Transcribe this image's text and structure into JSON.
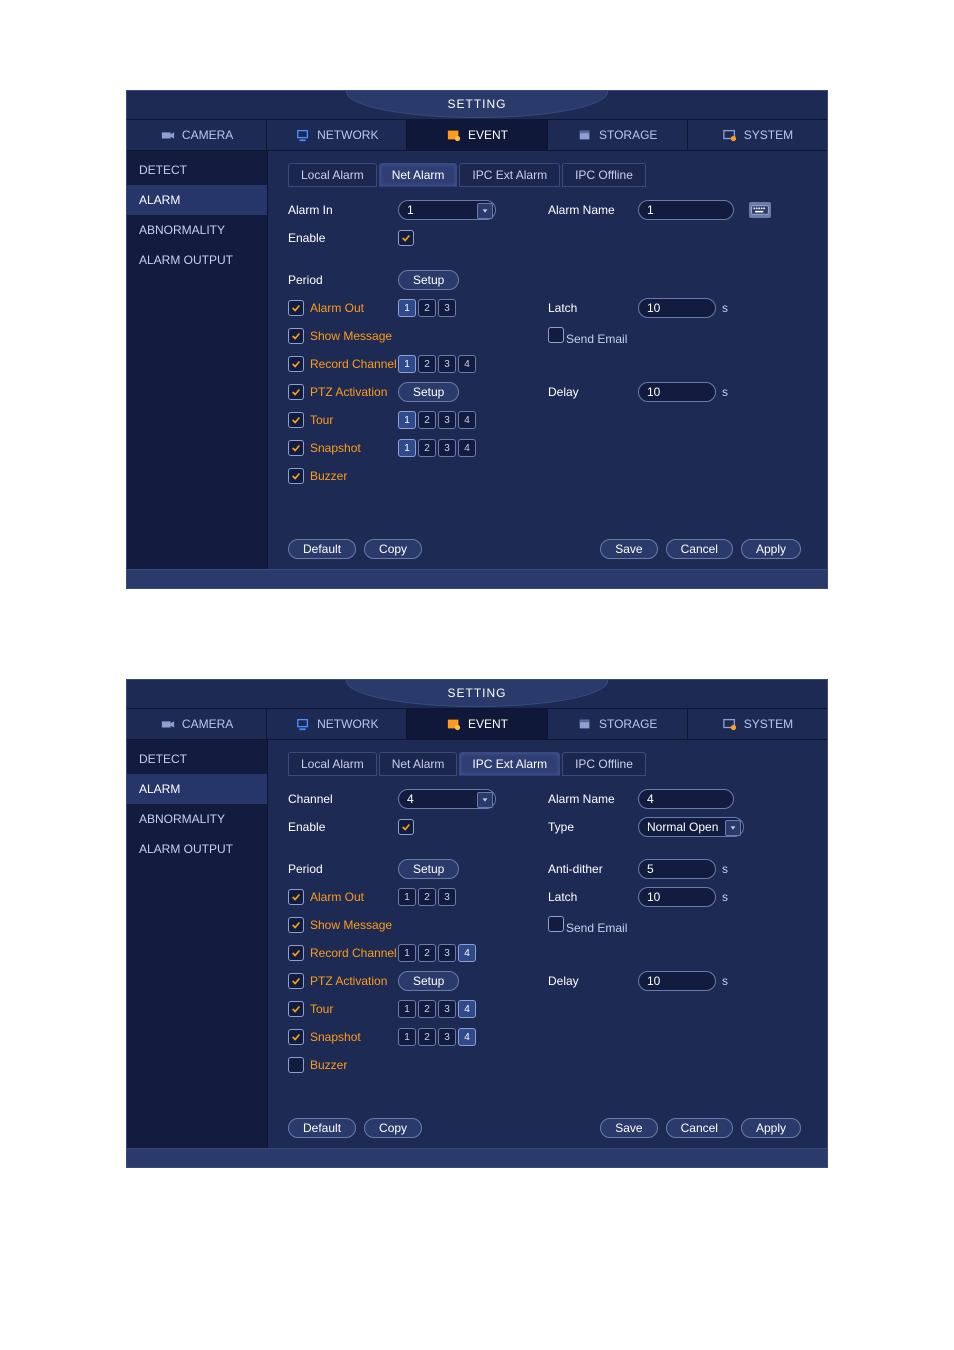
{
  "title": "SETTING",
  "topnav": [
    {
      "icon": "camera-icon",
      "label": "CAMERA"
    },
    {
      "icon": "network-icon",
      "label": "NETWORK"
    },
    {
      "icon": "event-icon",
      "label": "EVENT"
    },
    {
      "icon": "storage-icon",
      "label": "STORAGE"
    },
    {
      "icon": "system-icon",
      "label": "SYSTEM"
    }
  ],
  "topnav_active": 2,
  "sidebar": [
    "DETECT",
    "ALARM",
    "ABNORMALITY",
    "ALARM OUTPUT"
  ],
  "sidebar_active": 1,
  "tabs": [
    "Local Alarm",
    "Net Alarm",
    "IPC Ext Alarm",
    "IPC Offline"
  ],
  "labels": {
    "alarm_in": "Alarm In",
    "channel": "Channel",
    "alarm_name": "Alarm Name",
    "enable": "Enable",
    "type": "Type",
    "period": "Period",
    "setup": "Setup",
    "anti_dither": "Anti-dither",
    "alarm_out": "Alarm Out",
    "latch": "Latch",
    "show_message": "Show Message",
    "send_email": "Send Email",
    "record_channel": "Record Channel",
    "ptz_activation": "PTZ Activation",
    "delay": "Delay",
    "tour": "Tour",
    "snapshot": "Snapshot",
    "buzzer": "Buzzer",
    "unit_s": "s"
  },
  "footer": {
    "default": "Default",
    "copy": "Copy",
    "save": "Save",
    "cancel": "Cancel",
    "apply": "Apply"
  },
  "screens": [
    {
      "active_tab": 1,
      "show_channel_label": false,
      "show_type": false,
      "show_anti_dither": false,
      "alarm_in": "1",
      "alarm_name": "1",
      "enable": true,
      "latch": "10",
      "delay": "10",
      "alarm_out_channels": [
        true,
        false,
        false
      ],
      "record_channels": [
        true,
        false,
        false,
        false
      ],
      "tour_channels": [
        true,
        false,
        false,
        false
      ],
      "snapshot_channels": [
        true,
        false,
        false,
        false
      ],
      "checks": {
        "alarm_out": true,
        "show_message": true,
        "send_email": false,
        "record_channel": true,
        "ptz_activation": true,
        "tour": true,
        "snapshot": true,
        "buzzer": true
      },
      "footer_top_gap": 50
    },
    {
      "active_tab": 2,
      "show_channel_label": true,
      "show_type": true,
      "show_anti_dither": true,
      "alarm_in": "4",
      "alarm_name": "4",
      "type_value": "Normal Open",
      "anti_dither": "5",
      "enable": true,
      "latch": "10",
      "delay": "10",
      "alarm_out_channels": [
        false,
        false,
        false
      ],
      "record_channels": [
        false,
        false,
        false,
        true
      ],
      "tour_channels": [
        false,
        false,
        false,
        true
      ],
      "snapshot_channels": [
        false,
        false,
        false,
        true
      ],
      "checks": {
        "alarm_out": true,
        "show_message": true,
        "send_email": false,
        "record_channel": true,
        "ptz_activation": true,
        "tour": true,
        "snapshot": true,
        "buzzer": false
      },
      "footer_top_gap": 40
    }
  ]
}
